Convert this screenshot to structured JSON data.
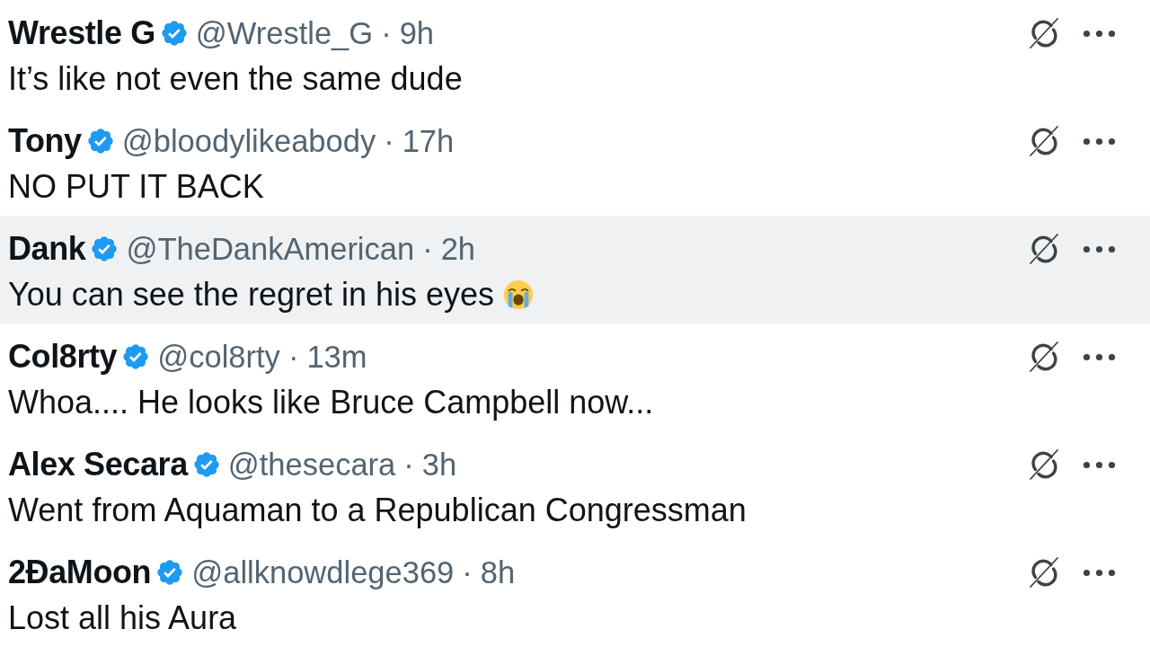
{
  "replies": [
    {
      "name": "Wrestle G",
      "verified": true,
      "handle": "@Wrestle_G",
      "separator": "·",
      "time": "9h",
      "text": "It’s like not even the same dude",
      "emoji": false,
      "hovered": false
    },
    {
      "name": "Tony",
      "verified": true,
      "handle": "@bloodylikeabody",
      "separator": "·",
      "time": "17h",
      "text": "NO PUT IT BACK",
      "emoji": false,
      "hovered": false
    },
    {
      "name": "Dank",
      "verified": true,
      "handle": "@TheDankAmerican",
      "separator": "·",
      "time": "2h",
      "text": "You can see the regret in his eyes",
      "emoji": true,
      "hovered": true
    },
    {
      "name": "Col8rty",
      "verified": true,
      "handle": "@col8rty",
      "separator": "·",
      "time": "13m",
      "text": "Whoa.... He looks like Bruce Campbell now...",
      "emoji": false,
      "hovered": false
    },
    {
      "name": "Alex Secara",
      "verified": true,
      "handle": "@thesecara",
      "separator": "·",
      "time": "3h",
      "text": "Went from Aquaman to a Republican Congressman",
      "emoji": false,
      "hovered": false
    },
    {
      "name": "2ĐaMoon",
      "verified": true,
      "handle": "@allknowdlege369",
      "separator": "·",
      "time": "8h",
      "text": "Lost all his Aura",
      "emoji": false,
      "hovered": false
    }
  ]
}
